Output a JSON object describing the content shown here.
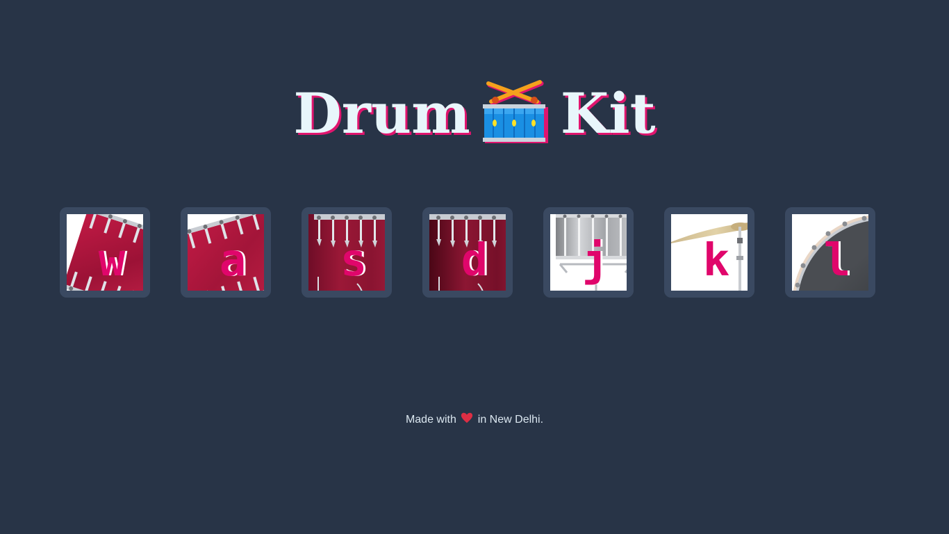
{
  "header": {
    "title_part1": "Drum",
    "title_part2": "Kit",
    "icon": "drum-with-sticks-icon"
  },
  "drums": [
    {
      "key": "w",
      "instrument": "tom-1"
    },
    {
      "key": "a",
      "instrument": "tom-2"
    },
    {
      "key": "s",
      "instrument": "tom-3"
    },
    {
      "key": "d",
      "instrument": "tom-4"
    },
    {
      "key": "j",
      "instrument": "snare"
    },
    {
      "key": "k",
      "instrument": "crash"
    },
    {
      "key": "l",
      "instrument": "kick-bass"
    }
  ],
  "footer": {
    "prefix": "Made with",
    "heart_icon": "red-heart-icon",
    "suffix": "in New Delhi."
  },
  "colors": {
    "background": "#283447",
    "tile_border": "#3a4961",
    "title": "#e8f6fb",
    "accent": "#e0066b"
  }
}
